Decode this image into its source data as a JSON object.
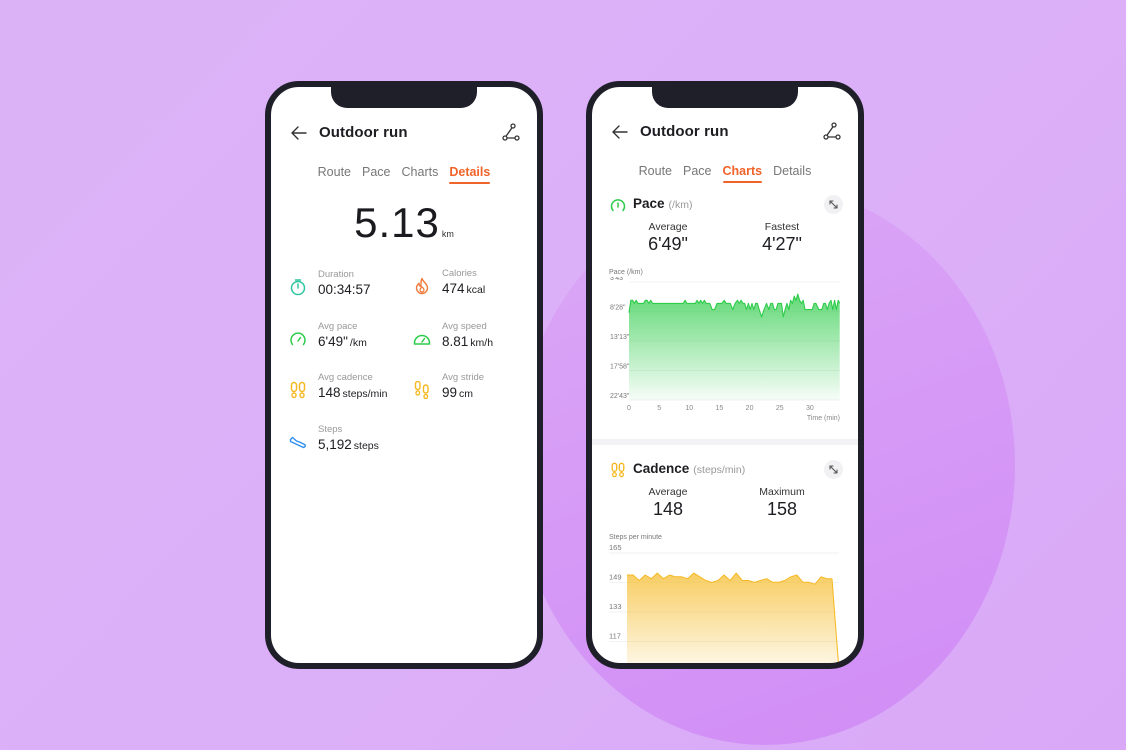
{
  "background": {
    "color": "#dcb0f8",
    "circle_color": "#d597f6"
  },
  "accent_color": "#f0632b",
  "phones": [
    {
      "header": {
        "title": "Outdoor run",
        "back_icon": "arrow-left-icon",
        "route_icon": "route-icon"
      },
      "tabs": [
        {
          "label": "Route",
          "active": false
        },
        {
          "label": "Pace",
          "active": false
        },
        {
          "label": "Charts",
          "active": false
        },
        {
          "label": "Details",
          "active": true
        }
      ],
      "distance": {
        "value": "5.13",
        "unit": "km"
      },
      "metrics": [
        {
          "label": "Duration",
          "value": "00:34:57",
          "unit": "",
          "icon": "stopwatch-icon",
          "color": "#2ec4a0"
        },
        {
          "label": "Calories",
          "value": "474",
          "unit": "kcal",
          "icon": "flame-icon",
          "color": "#f07a3a"
        },
        {
          "label": "Avg pace",
          "value": "6'49\"",
          "unit": "/km",
          "icon": "pace-gauge-icon",
          "color": "#2ecc4a"
        },
        {
          "label": "Avg speed",
          "value": "8.81",
          "unit": "km/h",
          "icon": "speedometer-icon",
          "color": "#2ecc4a"
        },
        {
          "label": "Avg cadence",
          "value": "148",
          "unit": "steps/min",
          "icon": "footprints-icon",
          "color": "#f5b820"
        },
        {
          "label": "Avg stride",
          "value": "99",
          "unit": "cm",
          "icon": "stride-footprints-icon",
          "color": "#f5b820"
        },
        {
          "label": "Steps",
          "value": "5,192",
          "unit": "steps",
          "icon": "shoe-icon",
          "color": "#2f8fef"
        }
      ]
    },
    {
      "header": {
        "title": "Outdoor run",
        "back_icon": "arrow-left-icon",
        "route_icon": "route-icon"
      },
      "tabs": [
        {
          "label": "Route",
          "active": false
        },
        {
          "label": "Pace",
          "active": false
        },
        {
          "label": "Charts",
          "active": true
        },
        {
          "label": "Details",
          "active": false
        }
      ],
      "pace_section": {
        "title": "Pace",
        "unit": "(/km)",
        "icon": "pace-gauge-icon",
        "color": "#2ecc4a",
        "stats": [
          {
            "label": "Average",
            "value": "6'49\""
          },
          {
            "label": "Fastest",
            "value": "4'27\""
          }
        ]
      },
      "cadence_section": {
        "title": "Cadence",
        "unit": "(steps/min)",
        "icon": "footprints-icon",
        "color": "#f5b820",
        "stats": [
          {
            "label": "Average",
            "value": "148"
          },
          {
            "label": "Maximum",
            "value": "158"
          }
        ]
      }
    }
  ],
  "chart_data": [
    {
      "type": "area",
      "title": "Pace",
      "ylabel": "Pace (/km)",
      "xlabel": "Time (min)",
      "y_tick_labels": [
        "3'43\"",
        "8'28\"",
        "13'13\"",
        "17'58\"",
        "22'43\""
      ],
      "y_ticks_sec": [
        223,
        508,
        793,
        1078,
        1363
      ],
      "ylim_sec": [
        223,
        1363
      ],
      "y_inverted": true,
      "x_tick_labels": [
        "0",
        "5",
        "10",
        "15",
        "20",
        "25",
        "30"
      ],
      "x_ticks": [
        0,
        5,
        10,
        15,
        20,
        25,
        30
      ],
      "xlim": [
        0,
        35
      ],
      "grid": true,
      "color": "#2ecc4a",
      "x": [
        0,
        0.3,
        0.6,
        0.9,
        1.2,
        1.5,
        1.8,
        2.1,
        2.4,
        2.7,
        3.0,
        3.3,
        3.6,
        3.9,
        4.2,
        4.5,
        5,
        6,
        7,
        8,
        9,
        9.3,
        9.6,
        10,
        10.5,
        11,
        11.3,
        11.6,
        11.9,
        12.2,
        12.5,
        12.8,
        13.1,
        13.4,
        13.8,
        14.2,
        14.6,
        15,
        15.4,
        15.8,
        16.1,
        16.4,
        16.8,
        17.2,
        17.6,
        18,
        18.3,
        18.6,
        18.9,
        19.2,
        19.5,
        19.8,
        20.1,
        20.4,
        20.7,
        21,
        21.3,
        21.6,
        22,
        22.4,
        22.8,
        23.2,
        23.5,
        23.8,
        24.1,
        24.4,
        24.7,
        25,
        25.3,
        25.6,
        25.9,
        26.2,
        26.5,
        26.8,
        27.1,
        27.4,
        27.7,
        28,
        28.3,
        28.6,
        28.9,
        29.2,
        29.5,
        29.8,
        30.1,
        30.4,
        30.7,
        31,
        31.5,
        32,
        32.3,
        32.6,
        32.9,
        33.2,
        33.5,
        33.8,
        34.1,
        34.4,
        34.7,
        34.95
      ],
      "y_sec": [
        520,
        400,
        400,
        430,
        400,
        430,
        430,
        430,
        430,
        400,
        400,
        430,
        400,
        430,
        430,
        430,
        430,
        430,
        430,
        430,
        430,
        400,
        430,
        430,
        430,
        430,
        400,
        430,
        400,
        430,
        400,
        430,
        430,
        430,
        490,
        490,
        430,
        430,
        430,
        400,
        430,
        430,
        430,
        490,
        430,
        400,
        430,
        400,
        430,
        430,
        490,
        430,
        490,
        430,
        490,
        430,
        430,
        490,
        560,
        490,
        430,
        490,
        430,
        430,
        490,
        490,
        430,
        430,
        430,
        560,
        490,
        430,
        490,
        400,
        430,
        360,
        400,
        340,
        400,
        430,
        400,
        490,
        490,
        490,
        490,
        490,
        430,
        430,
        490,
        490,
        430,
        430,
        490,
        430,
        400,
        490,
        400,
        490,
        400,
        430
      ]
    },
    {
      "type": "area",
      "title": "Cadence",
      "ylabel": "Steps per minute",
      "y_ticks": [
        165,
        149,
        133,
        117
      ],
      "ylim": [
        105,
        165
      ],
      "grid": true,
      "color": "#f5b820",
      "x": [
        0,
        1,
        2,
        3,
        4,
        5,
        6,
        7,
        8,
        9,
        10,
        11,
        12,
        13,
        14,
        15,
        16,
        17,
        18,
        19,
        20,
        21,
        22,
        23,
        24,
        25,
        26,
        27,
        28,
        29,
        30,
        31,
        32,
        33,
        33.8,
        34.95
      ],
      "values": [
        152,
        152,
        149,
        152,
        150,
        153,
        150,
        152,
        151,
        151,
        150,
        153,
        151,
        149,
        148,
        149,
        152,
        149,
        153,
        149,
        149,
        148,
        149,
        150,
        148,
        148,
        149,
        151,
        152,
        148,
        148,
        147,
        151,
        150,
        150,
        100
      ]
    }
  ]
}
